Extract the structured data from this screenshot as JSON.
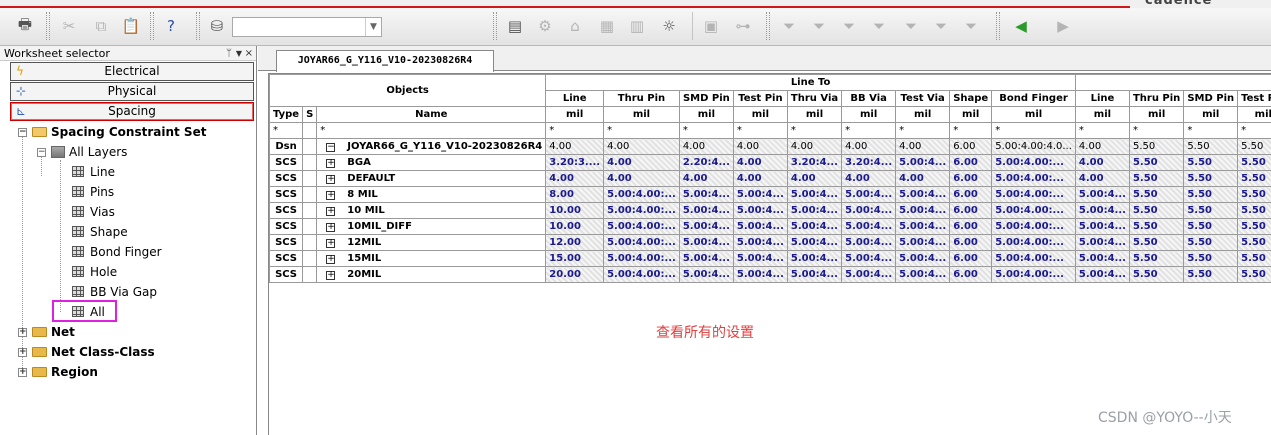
{
  "brand": {
    "logo": "cadence"
  },
  "toolbar": {
    "combo_value": ""
  },
  "left_panel": {
    "title": "Worksheet selector",
    "worksheets": [
      {
        "label": "Electrical",
        "icon": "lightning-icon"
      },
      {
        "label": "Physical",
        "icon": "physical-icon"
      },
      {
        "label": "Spacing",
        "icon": "spacing-icon",
        "active": true
      }
    ],
    "tree": {
      "spacing_set": "Spacing Constraint Set",
      "all_layers": "All Layers",
      "items": [
        "Line",
        "Pins",
        "Vias",
        "Shape",
        "Bond Finger",
        "Hole",
        "BB Via Gap",
        "All"
      ],
      "others": [
        "Net",
        "Net Class-Class",
        "Region"
      ]
    }
  },
  "doc_tab": "JOYAR66_G_Y116_V10-20230826R4",
  "table": {
    "objects_label": "Objects",
    "group_label": "Line To",
    "type_label": "Type",
    "s_label": "S",
    "name_label": "Name",
    "columns": [
      "Line",
      "Thru Pin",
      "SMD Pin",
      "Test Pin",
      "Thru Via",
      "BB Via",
      "Test Via",
      "Shape",
      "Bond Finger",
      "Line",
      "Thru Pin",
      "SMD Pin",
      "Test Pin"
    ],
    "units": [
      "mil",
      "mil",
      "mil",
      "mil",
      "mil",
      "mil",
      "mil",
      "mil",
      "mil",
      "mil",
      "mil",
      "mil",
      "mil"
    ],
    "star": "*",
    "rows": [
      {
        "type": "Dsn",
        "name": "JOYAR66_G_Y116_V10-20230826R4",
        "expander": "−",
        "values": [
          "4.00",
          "4.00",
          "4.00",
          "4.00",
          "4.00",
          "4.00",
          "4.00",
          "6.00",
          "5.00:4.00:4.0...",
          "4.00",
          "5.50",
          "5.50",
          "5.50"
        ]
      },
      {
        "type": "SCS",
        "name": "BGA",
        "expander": "+",
        "values": [
          "3.20:3....",
          "4.00",
          "2.20:4...",
          "4.00",
          "3.20:4...",
          "3.20:4...",
          "5.00:4...",
          "6.00",
          "5.00:4.00:...",
          "4.00",
          "5.50",
          "5.50",
          "5.50"
        ]
      },
      {
        "type": "SCS",
        "name": "DEFAULT",
        "expander": "+",
        "values": [
          "4.00",
          "4.00",
          "4.00",
          "4.00",
          "4.00",
          "4.00",
          "4.00",
          "6.00",
          "5.00:4.00:...",
          "4.00",
          "5.50",
          "5.50",
          "5.50"
        ]
      },
      {
        "type": "SCS",
        "name": "8 MIL",
        "expander": "+",
        "values": [
          "8.00",
          "5.00:4.00:...",
          "5.00:4...",
          "5.00:4...",
          "5.00:4...",
          "5.00:4...",
          "5.00:4...",
          "6.00",
          "5.00:4.00:...",
          "5.00:4...",
          "5.50",
          "5.50",
          "5.50"
        ]
      },
      {
        "type": "SCS",
        "name": "10 MIL",
        "expander": "+",
        "values": [
          "10.00",
          "5.00:4.00:...",
          "5.00:4...",
          "5.00:4...",
          "5.00:4...",
          "5.00:4...",
          "5.00:4...",
          "6.00",
          "5.00:4.00:...",
          "5.00:4...",
          "5.50",
          "5.50",
          "5.50"
        ]
      },
      {
        "type": "SCS",
        "name": "10MIL_DIFF",
        "expander": "+",
        "values": [
          "10.00",
          "5.00:4.00:...",
          "5.00:4...",
          "5.00:4...",
          "5.00:4...",
          "5.00:4...",
          "5.00:4...",
          "6.00",
          "5.00:4.00:...",
          "5.00:4...",
          "5.50",
          "5.50",
          "5.50"
        ]
      },
      {
        "type": "SCS",
        "name": "12MIL",
        "expander": "+",
        "values": [
          "12.00",
          "5.00:4.00:...",
          "5.00:4...",
          "5.00:4...",
          "5.00:4...",
          "5.00:4...",
          "5.00:4...",
          "6.00",
          "5.00:4.00:...",
          "5.00:4...",
          "5.50",
          "5.50",
          "5.50"
        ]
      },
      {
        "type": "SCS",
        "name": "15MIL",
        "expander": "+",
        "values": [
          "15.00",
          "5.00:4.00:...",
          "5.00:4...",
          "5.00:4...",
          "5.00:4...",
          "5.00:4...",
          "5.00:4...",
          "6.00",
          "5.00:4.00:...",
          "5.00:4...",
          "5.50",
          "5.50",
          "5.50"
        ]
      },
      {
        "type": "SCS",
        "name": "20MIL",
        "expander": "+",
        "values": [
          "20.00",
          "5.00:4.00:...",
          "5.00:4...",
          "5.00:4...",
          "5.00:4...",
          "5.00:4...",
          "5.00:4...",
          "6.00",
          "5.00:4.00:...",
          "5.00:4...",
          "5.50",
          "5.50",
          "5.50"
        ]
      }
    ]
  },
  "annotation": "查看所有的设置",
  "watermark": "CSDN @YOYO--小天",
  "colors": {
    "accent_red": "#d01818",
    "highlight_magenta": "#e020e0",
    "annotation_red": "#e04040",
    "value_blue": "#1a1a8c"
  }
}
